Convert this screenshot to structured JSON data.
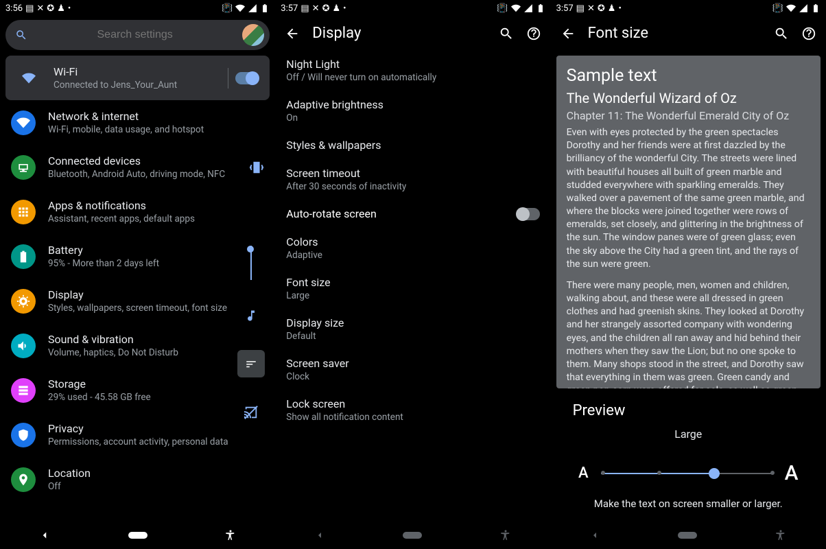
{
  "s1": {
    "status_time": "3:56",
    "search_placeholder": "Search settings",
    "wifi": {
      "title": "Wi-Fi",
      "sub": "Connected to Jens_Your_Aunt"
    },
    "items": [
      {
        "title": "Network & internet",
        "sub": "Wi-Fi, mobile, data usage, and hotspot",
        "color": "#1a73e8",
        "icon": "wifi"
      },
      {
        "title": "Connected devices",
        "sub": "Bluetooth, Android Auto, driving mode, NFC",
        "color": "#1e8e3e",
        "icon": "devices"
      },
      {
        "title": "Apps & notifications",
        "sub": "Assistant, recent apps, default apps",
        "color": "#f29900",
        "icon": "apps"
      },
      {
        "title": "Battery",
        "sub": "95% - More than 2 days left",
        "color": "#009688",
        "icon": "battery"
      },
      {
        "title": "Display",
        "sub": "Styles, wallpapers, screen timeout, font size",
        "color": "#f29900",
        "icon": "display"
      },
      {
        "title": "Sound & vibration",
        "sub": "Volume, haptics, Do Not Disturb",
        "color": "#00acc1",
        "icon": "sound"
      },
      {
        "title": "Storage",
        "sub": "29% used - 45.58 GB free",
        "color": "#e040fb",
        "icon": "storage"
      },
      {
        "title": "Privacy",
        "sub": "Permissions, account activity, personal data",
        "color": "#1a73e8",
        "icon": "privacy"
      },
      {
        "title": "Location",
        "sub": "Off",
        "color": "#1e8e3e",
        "icon": "location"
      }
    ]
  },
  "s2": {
    "status_time": "3:57",
    "title": "Display",
    "items": [
      {
        "t": "Night Light",
        "s": "Off / Will never turn on automatically"
      },
      {
        "t": "Adaptive brightness",
        "s": "On"
      },
      {
        "t": "Styles & wallpapers",
        "s": ""
      },
      {
        "t": "Screen timeout",
        "s": "After 30 seconds of inactivity"
      },
      {
        "t": "Auto-rotate screen",
        "s": "",
        "toggle": "off"
      },
      {
        "t": "Colors",
        "s": "Adaptive"
      },
      {
        "t": "Font size",
        "s": "Large"
      },
      {
        "t": "Display size",
        "s": "Default"
      },
      {
        "t": "Screen saver",
        "s": "Clock"
      },
      {
        "t": "Lock screen",
        "s": "Show all notification content"
      }
    ]
  },
  "s3": {
    "status_time": "3:57",
    "title": "Font size",
    "sample": {
      "h1": "Sample text",
      "h2": "The Wonderful Wizard of Oz",
      "h3": "Chapter 11: The Wonderful Emerald City of Oz",
      "p1": "Even with eyes protected by the green spectacles Dorothy and her friends were at first dazzled by the brilliancy of the wonderful City. The streets were lined with beautiful houses all built of green marble and studded everywhere with sparkling emeralds. They walked over a pavement of the same green marble, and where the blocks were joined together were rows of emeralds, set closely, and glittering in the brightness of the sun. The window panes were of green glass; even the sky above the City had a green tint, and the rays of the sun were green.",
      "p2": "There were many people, men, women and children, walking about, and these were all dressed in green clothes and had greenish skins. They looked at Dorothy and her strangely assorted company with wondering eyes, and the children all ran away and hid behind their mothers when they saw the Lion; but no one spoke to them. Many shops stood in the street, and Dorothy saw that everything in them was green. Green candy and green pop-corn were offered for sale, as well as green shoes, green hats and green"
    },
    "preview_label": "Preview",
    "size_label": "Large",
    "hint": "Make the text on screen smaller or larger.",
    "small_a": "A",
    "big_a": "A"
  }
}
